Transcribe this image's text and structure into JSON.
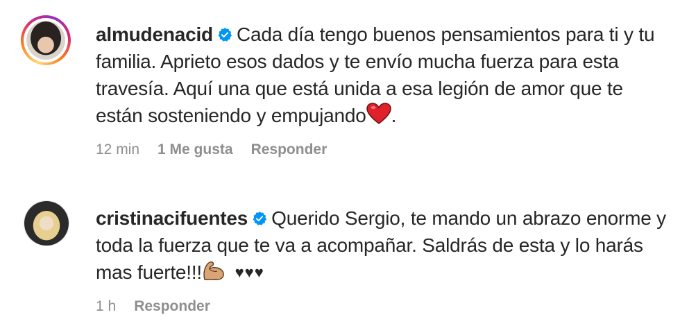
{
  "comments": [
    {
      "username": "almudenacid",
      "text_before_emoji": "Cada día tengo buenos pensamientos para ti y tu familia. Aprieto esos dados y te envío mucha fuerza para esta travesía. Aquí una que está unida a esa legión de amor que te están sosteniendo y empujando",
      "text_after_emoji": ".",
      "emoji": "red-heart-icon",
      "time": "12 min",
      "likes": "1 Me gusta",
      "reply_label": "Responder",
      "has_story_ring": true
    },
    {
      "username": "cristinacifuentes",
      "text_before_emoji": "Querido Sergio, te mando un abrazo enorme y toda la fuerza que te va a acompañar. Saldrás de esta y lo harás mas fuerte!!!",
      "emoji": "flexed-biceps-icon",
      "trailing_emoji": "♥♥♥",
      "time": "1 h",
      "reply_label": "Responder",
      "has_story_ring": false
    }
  ],
  "colors": {
    "verified_blue": "#0095f6",
    "meta_gray": "#8e8e8e",
    "text": "#262626",
    "heart_red": "#e0202b"
  }
}
